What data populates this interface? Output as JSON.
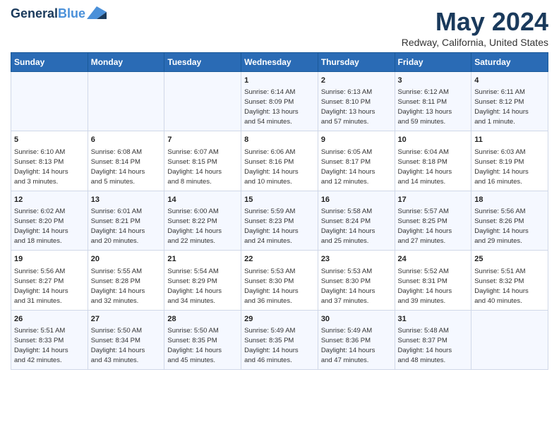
{
  "logo": {
    "line1": "General",
    "line2": "Blue"
  },
  "title": "May 2024",
  "subtitle": "Redway, California, United States",
  "headers": [
    "Sunday",
    "Monday",
    "Tuesday",
    "Wednesday",
    "Thursday",
    "Friday",
    "Saturday"
  ],
  "weeks": [
    [
      {
        "day": "",
        "info": ""
      },
      {
        "day": "",
        "info": ""
      },
      {
        "day": "",
        "info": ""
      },
      {
        "day": "1",
        "info": "Sunrise: 6:14 AM\nSunset: 8:09 PM\nDaylight: 13 hours\nand 54 minutes."
      },
      {
        "day": "2",
        "info": "Sunrise: 6:13 AM\nSunset: 8:10 PM\nDaylight: 13 hours\nand 57 minutes."
      },
      {
        "day": "3",
        "info": "Sunrise: 6:12 AM\nSunset: 8:11 PM\nDaylight: 13 hours\nand 59 minutes."
      },
      {
        "day": "4",
        "info": "Sunrise: 6:11 AM\nSunset: 8:12 PM\nDaylight: 14 hours\nand 1 minute."
      }
    ],
    [
      {
        "day": "5",
        "info": "Sunrise: 6:10 AM\nSunset: 8:13 PM\nDaylight: 14 hours\nand 3 minutes."
      },
      {
        "day": "6",
        "info": "Sunrise: 6:08 AM\nSunset: 8:14 PM\nDaylight: 14 hours\nand 5 minutes."
      },
      {
        "day": "7",
        "info": "Sunrise: 6:07 AM\nSunset: 8:15 PM\nDaylight: 14 hours\nand 8 minutes."
      },
      {
        "day": "8",
        "info": "Sunrise: 6:06 AM\nSunset: 8:16 PM\nDaylight: 14 hours\nand 10 minutes."
      },
      {
        "day": "9",
        "info": "Sunrise: 6:05 AM\nSunset: 8:17 PM\nDaylight: 14 hours\nand 12 minutes."
      },
      {
        "day": "10",
        "info": "Sunrise: 6:04 AM\nSunset: 8:18 PM\nDaylight: 14 hours\nand 14 minutes."
      },
      {
        "day": "11",
        "info": "Sunrise: 6:03 AM\nSunset: 8:19 PM\nDaylight: 14 hours\nand 16 minutes."
      }
    ],
    [
      {
        "day": "12",
        "info": "Sunrise: 6:02 AM\nSunset: 8:20 PM\nDaylight: 14 hours\nand 18 minutes."
      },
      {
        "day": "13",
        "info": "Sunrise: 6:01 AM\nSunset: 8:21 PM\nDaylight: 14 hours\nand 20 minutes."
      },
      {
        "day": "14",
        "info": "Sunrise: 6:00 AM\nSunset: 8:22 PM\nDaylight: 14 hours\nand 22 minutes."
      },
      {
        "day": "15",
        "info": "Sunrise: 5:59 AM\nSunset: 8:23 PM\nDaylight: 14 hours\nand 24 minutes."
      },
      {
        "day": "16",
        "info": "Sunrise: 5:58 AM\nSunset: 8:24 PM\nDaylight: 14 hours\nand 25 minutes."
      },
      {
        "day": "17",
        "info": "Sunrise: 5:57 AM\nSunset: 8:25 PM\nDaylight: 14 hours\nand 27 minutes."
      },
      {
        "day": "18",
        "info": "Sunrise: 5:56 AM\nSunset: 8:26 PM\nDaylight: 14 hours\nand 29 minutes."
      }
    ],
    [
      {
        "day": "19",
        "info": "Sunrise: 5:56 AM\nSunset: 8:27 PM\nDaylight: 14 hours\nand 31 minutes."
      },
      {
        "day": "20",
        "info": "Sunrise: 5:55 AM\nSunset: 8:28 PM\nDaylight: 14 hours\nand 32 minutes."
      },
      {
        "day": "21",
        "info": "Sunrise: 5:54 AM\nSunset: 8:29 PM\nDaylight: 14 hours\nand 34 minutes."
      },
      {
        "day": "22",
        "info": "Sunrise: 5:53 AM\nSunset: 8:30 PM\nDaylight: 14 hours\nand 36 minutes."
      },
      {
        "day": "23",
        "info": "Sunrise: 5:53 AM\nSunset: 8:30 PM\nDaylight: 14 hours\nand 37 minutes."
      },
      {
        "day": "24",
        "info": "Sunrise: 5:52 AM\nSunset: 8:31 PM\nDaylight: 14 hours\nand 39 minutes."
      },
      {
        "day": "25",
        "info": "Sunrise: 5:51 AM\nSunset: 8:32 PM\nDaylight: 14 hours\nand 40 minutes."
      }
    ],
    [
      {
        "day": "26",
        "info": "Sunrise: 5:51 AM\nSunset: 8:33 PM\nDaylight: 14 hours\nand 42 minutes."
      },
      {
        "day": "27",
        "info": "Sunrise: 5:50 AM\nSunset: 8:34 PM\nDaylight: 14 hours\nand 43 minutes."
      },
      {
        "day": "28",
        "info": "Sunrise: 5:50 AM\nSunset: 8:35 PM\nDaylight: 14 hours\nand 45 minutes."
      },
      {
        "day": "29",
        "info": "Sunrise: 5:49 AM\nSunset: 8:35 PM\nDaylight: 14 hours\nand 46 minutes."
      },
      {
        "day": "30",
        "info": "Sunrise: 5:49 AM\nSunset: 8:36 PM\nDaylight: 14 hours\nand 47 minutes."
      },
      {
        "day": "31",
        "info": "Sunrise: 5:48 AM\nSunset: 8:37 PM\nDaylight: 14 hours\nand 48 minutes."
      },
      {
        "day": "",
        "info": ""
      }
    ]
  ]
}
